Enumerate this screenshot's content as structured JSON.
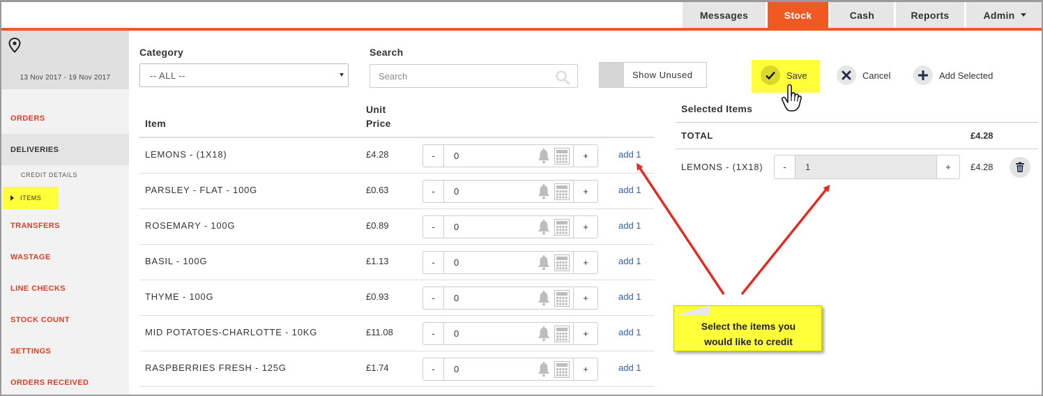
{
  "nav": {
    "tabs": [
      {
        "label": "Messages"
      },
      {
        "label": "Stock"
      },
      {
        "label": "Cash"
      },
      {
        "label": "Reports"
      },
      {
        "label": "Admin"
      }
    ],
    "active_color": "#f05a22"
  },
  "sidebar": {
    "location_icon": "map-pin-icon",
    "date_range": "13 Nov 2017 - 19 Nov 2017",
    "items": [
      {
        "label": "ORDERS"
      },
      {
        "label": "DELIVERIES"
      },
      {
        "label": "TRANSFERS"
      },
      {
        "label": "WASTAGE"
      },
      {
        "label": "LINE CHECKS"
      },
      {
        "label": "STOCK COUNT"
      },
      {
        "label": "SETTINGS"
      },
      {
        "label": "ORDERS RECEIVED"
      }
    ],
    "sub_items": [
      {
        "label": "CREDIT DETAILS"
      },
      {
        "label": "ITEMS"
      }
    ]
  },
  "filters": {
    "category_label": "Category",
    "category_value": "-- ALL --",
    "search_label": "Search",
    "search_placeholder": "Search",
    "show_unused_label": "Show Unused"
  },
  "actions": {
    "save": "Save",
    "cancel": "Cancel",
    "add_selected": "Add Selected"
  },
  "items_table": {
    "col_item": "Item",
    "col_unit": "Unit",
    "col_price": "Price",
    "add_label": "add 1",
    "rows": [
      {
        "name": "LEMONS - (1X18)",
        "price": "£4.28",
        "qty": "0"
      },
      {
        "name": "PARSLEY - FLAT - 100G",
        "price": "£0.63",
        "qty": "0"
      },
      {
        "name": "ROSEMARY - 100G",
        "price": "£0.89",
        "qty": "0"
      },
      {
        "name": "BASIL - 100G",
        "price": "£1.13",
        "qty": "0"
      },
      {
        "name": "THYME - 100G",
        "price": "£0.93",
        "qty": "0"
      },
      {
        "name": "MID POTATOES-CHARLOTTE - 10KG",
        "price": "£11.08",
        "qty": "0"
      },
      {
        "name": "RASPBERRIES FRESH - 125G",
        "price": "£1.74",
        "qty": "0"
      }
    ]
  },
  "selected": {
    "title": "Selected Items",
    "total_label": "TOTAL",
    "total_value": "£4.28",
    "items": [
      {
        "name": "LEMONS - (1X18)",
        "qty": "1",
        "price": "£4.28"
      }
    ]
  },
  "callout": {
    "line1": "Select the items you",
    "line2": "would like to credit"
  },
  "highlight_color": "#ffff3a",
  "arrow_color": "#e52a22"
}
